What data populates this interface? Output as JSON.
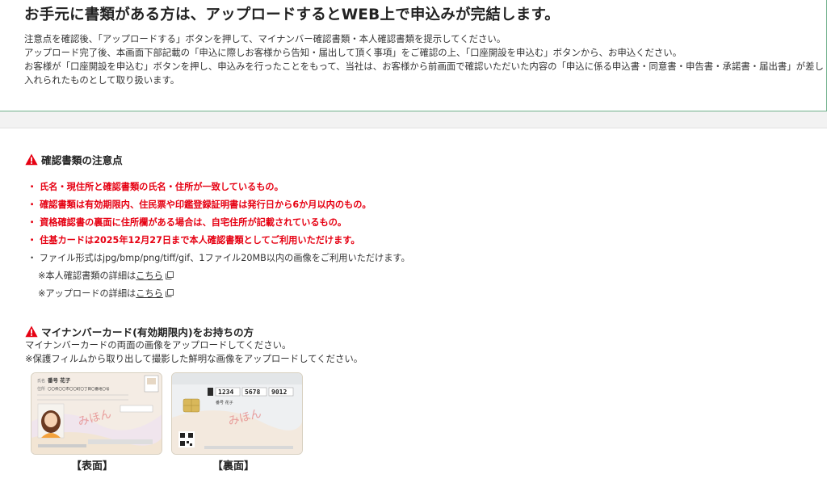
{
  "top": {
    "title": "お手元に書類がある方は、アップロードするとWEB上で申込みが完結します。",
    "lines": [
      "注意点を確認後、「アップロードする」ボタンを押して、マイナンバー確認書類・本人確認書類を提示してください。",
      "アップロード完了後、本画面下部記載の「申込に際しお客様から告知・届出して頂く事項」をご確認の上、「口座開設を申込む」ボタンから、お申込ください。",
      "お客様が「口座開設を申込む」ボタンを押し、申込みを行ったことをもって、当社は、お客様から前画面で確認いただいた内容の「申込に係る申込書・同意書・申告書・承諾書・届出書」が差し入れられたものとして取り扱います。"
    ]
  },
  "notes_section": {
    "heading": "確認書類の注意点",
    "red_items": [
      "・ 氏名・現住所と確認書類の氏名・住所が一致しているもの。",
      "・ 確認書類は有効期限内、住民票や印鑑登録証明書は発行日から6か月以内のもの。",
      "・ 資格確認書の裏面に住所欄がある場合は、自宅住所が記載されているもの。",
      "・ 住基カードは2025年12月27日まで本人確認書類としてご利用いただけます。"
    ],
    "plain_item": "・ ファイル形式はjpg/bmp/png/tiff/gif、1ファイル20MB以内の画像をご利用いただけます。",
    "detail_1_prefix": "※本人確認書類の詳細は",
    "detail_2_prefix": "※アップロードの詳細は",
    "link_label": "こちら"
  },
  "mynumber_section": {
    "heading": "マイナンバーカード(有効期限内)をお持ちの方",
    "line1": "マイナンバーカードの両面の画像をアップロードしてください。",
    "line2": "※保護フィルムから取り出して撮影した鮮明な画像をアップロードしてください。",
    "front_caption": "【表面】",
    "back_caption": "【裏面】",
    "front_card": {
      "name_label": "氏名",
      "name_value": "番号 花子",
      "address_label": "住所",
      "address_value": "〇〇県〇〇市〇〇町〇丁目〇番地〇号",
      "watermark": "みほん",
      "number_digits": "1234 5678 9012"
    },
    "back_card": {
      "number_groups": [
        "1234",
        "5678",
        "9012"
      ],
      "watermark": "みほん",
      "name_value": "番号 花子"
    }
  },
  "colors": {
    "accent_red": "#e60012",
    "border_green": "#6fb08a"
  }
}
